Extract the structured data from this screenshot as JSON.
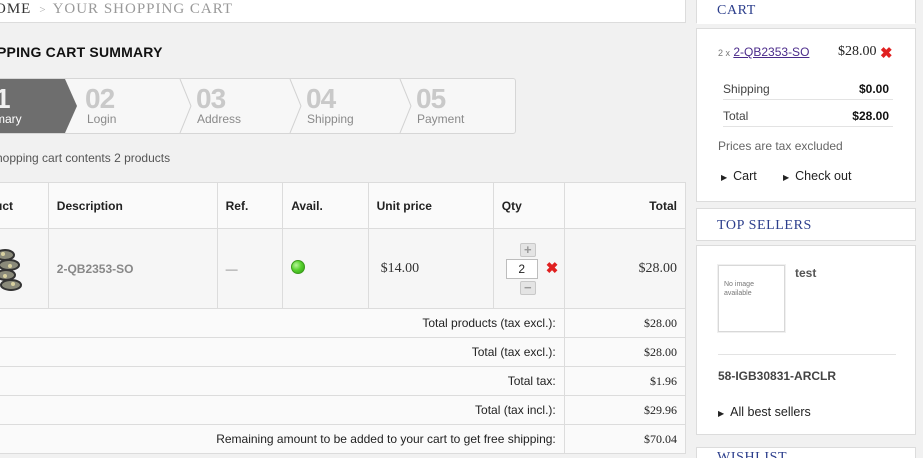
{
  "breadcrumb": {
    "home": "OME",
    "separator": ">",
    "current": "YOUR SHOPPING CART"
  },
  "page_title": "PPING CART SUMMARY",
  "steps": [
    {
      "num": "1",
      "label": "mary",
      "current": true
    },
    {
      "num": "02",
      "label": "Login"
    },
    {
      "num": "03",
      "label": "Address"
    },
    {
      "num": "04",
      "label": "Shipping"
    },
    {
      "num": "05",
      "label": "Payment"
    }
  ],
  "cart_count_text": "hopping cart contents 2 products",
  "table": {
    "headers": [
      "uct",
      "Description",
      "Ref.",
      "Avail.",
      "Unit price",
      "Qty",
      "Total"
    ],
    "row": {
      "description": "2-QB2353-SO",
      "ref": "—",
      "unit_price": "$14.00",
      "qty": "2",
      "qty_plus": "+",
      "qty_minus": "−",
      "total": "$28.00"
    },
    "totals": [
      {
        "label": "Total products (tax excl.):",
        "value": "$28.00"
      },
      {
        "label": "Total (tax excl.):",
        "value": "$28.00"
      },
      {
        "label": "Total tax:",
        "value": "$1.96"
      },
      {
        "label": "Total (tax incl.):",
        "value": "$29.96"
      },
      {
        "label": "Remaining amount to be added to your cart to get free shipping:",
        "value": "$70.04"
      }
    ]
  },
  "sidebar_cart": {
    "title": "CART",
    "item": {
      "mult": "2 x",
      "name": "2-QB2353-SO",
      "price": "$28.00"
    },
    "shipping_label": "Shipping",
    "shipping_value": "$0.00",
    "total_label": "Total",
    "total_value": "$28.00",
    "tax_note": "Prices are tax excluded",
    "cart_link": "Cart",
    "checkout_link": "Check out"
  },
  "top_sellers": {
    "title": "TOP SELLERS",
    "no_image": "No image available",
    "product_name": "test",
    "product_ref": "58-IGB30831-ARCLR",
    "all_link": "All best sellers"
  },
  "wishlist": {
    "title": "WISHLIST"
  },
  "colors": {
    "accent_title": "#2c3e8c",
    "delete": "#e02020",
    "available": "#58d22e",
    "step_current": "#6e6e6e"
  }
}
